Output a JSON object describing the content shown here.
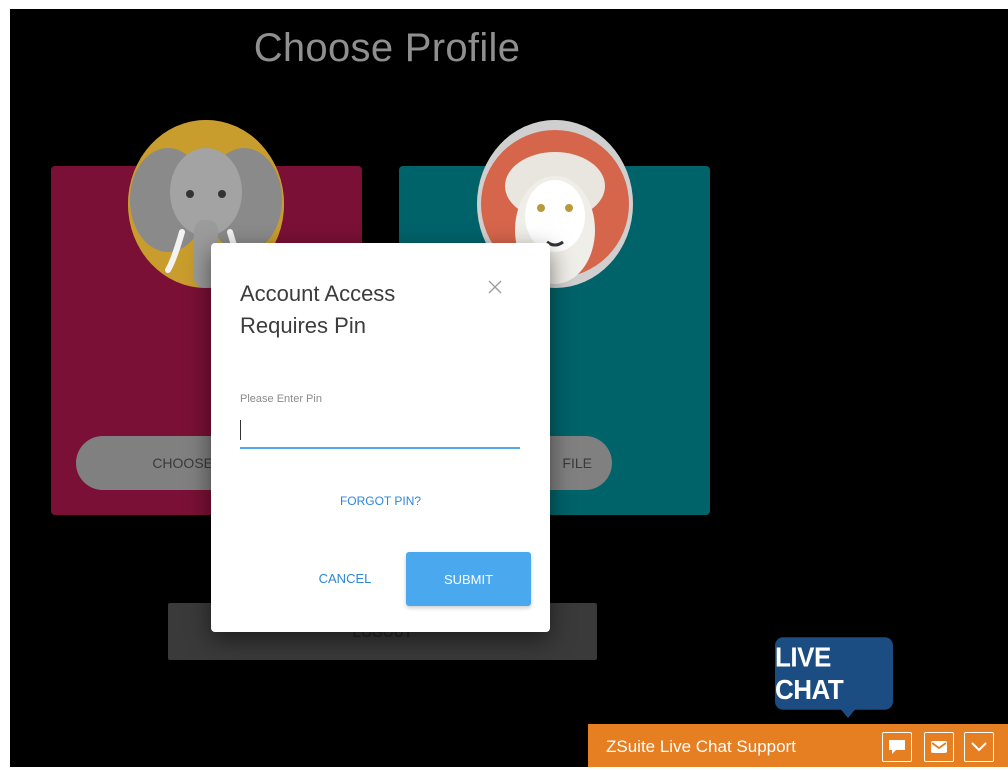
{
  "page": {
    "title": "Choose Profile"
  },
  "profiles": [
    {
      "avatar_icon": "elephant-icon",
      "choose_label": "CHOOSE PROFI"
    },
    {
      "avatar_icon": "sheep-icon",
      "choose_label": "FILE"
    }
  ],
  "logout": {
    "label": "LOGOUT"
  },
  "modal": {
    "title": "Account Access Requires Pin",
    "close_icon": "close-icon",
    "pin_label": "Please Enter Pin",
    "pin_value": "",
    "forgot_label": "FORGOT PIN?",
    "cancel_label": "CANCEL",
    "submit_label": "SUBMIT"
  },
  "live_chat": {
    "bubble_label": "LIVE CHAT",
    "bar_title": "ZSuite Live Chat Support",
    "buttons": [
      "chat-icon",
      "email-icon",
      "chevron-down-icon"
    ]
  },
  "colors": {
    "card_1": "#7a1035",
    "card_2": "#00636a",
    "accent_blue": "#4aa8ef",
    "chat_orange": "#e67e22",
    "chat_bubble": "#1c4d82"
  }
}
